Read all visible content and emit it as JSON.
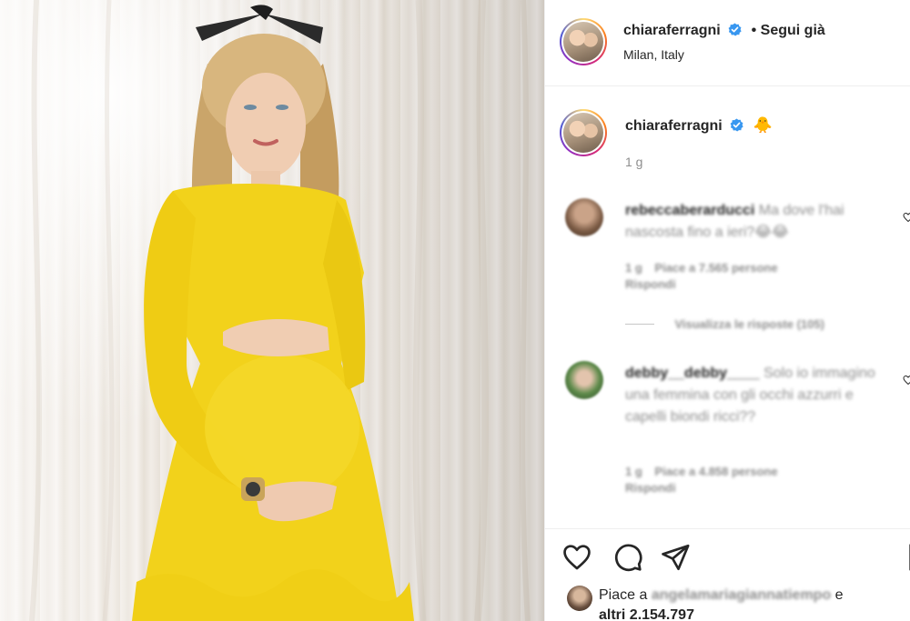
{
  "post": {
    "author": {
      "username": "chiaraferragni",
      "verified": true,
      "follow_status": "• Segui già",
      "location": "Milan, Italy"
    },
    "caption": {
      "username": "chiaraferragni",
      "emoji": "🐥",
      "time": "1 g"
    },
    "comments": [
      {
        "username": "rebeccaberarducci",
        "text": "Ma dove l'hai nascosta fino a ieri?😂😂",
        "time": "1 g",
        "likes": "Piace a 7.565 persone",
        "reply": "Rispondi",
        "view_replies": "Visualizza le risposte (105)"
      },
      {
        "username": "debby__debby____",
        "text": "Solo io immagino una femmina con gli occhi azzurri e capelli biondi ricci??",
        "time": "1 g",
        "likes": "Piace a 4.858 persone",
        "reply": "Rispondi"
      }
    ],
    "likes_summary": {
      "prefix": "Piace a",
      "user": "angelamariagiannatiempo",
      "suffix": "e",
      "others": "altri 2.154.797"
    }
  },
  "icons": {
    "like": "heart-icon",
    "comment": "comment-icon",
    "share": "paper-plane-icon",
    "save": "bookmark-icon",
    "verified": "verified-badge-icon",
    "comment_like": "heart-icon"
  },
  "colors": {
    "verified_blue": "#3897f0",
    "dress_yellow": "#f2d21b",
    "muted_text": "#8e8e8e",
    "text": "#262626"
  }
}
